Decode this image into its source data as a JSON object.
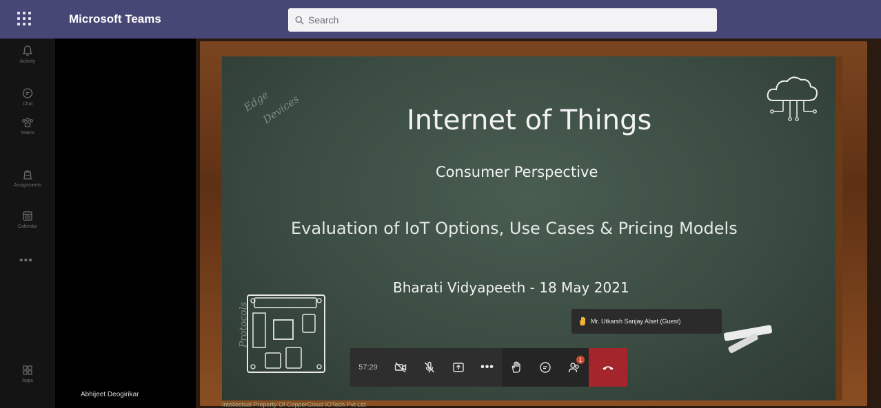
{
  "header": {
    "app_title": "Microsoft Teams",
    "search_placeholder": "Search"
  },
  "rail": {
    "items": [
      {
        "label": "Activity",
        "icon": "bell-icon"
      },
      {
        "label": "Chat",
        "icon": "chat-icon"
      },
      {
        "label": "Teams",
        "icon": "teams-icon"
      },
      {
        "label": "Assignments",
        "icon": "assignments-icon"
      },
      {
        "label": "Calendar",
        "icon": "calendar-icon"
      }
    ],
    "more_label": "•••",
    "apps_label": "Apps"
  },
  "presenter_name": "Abhijeet Deogirikar",
  "slide": {
    "title": "Internet of Things",
    "subtitle": "Consumer Perspective",
    "tagline": "Evaluation of IoT Options, Use Cases & Pricing Models",
    "date_line": "Bharati Vidyapeeth - 18 May 2021",
    "chalk_edge": "Edge",
    "chalk_devices": "Devices",
    "chalk_protocols": "Protocols",
    "footer": "Intellectual Property Of CopperCloud IOTech Pvt Ltd"
  },
  "raised_hand": {
    "name": "Mr. Utkarsh Sanjay Alset (Guest)"
  },
  "call_controls": {
    "timer": "57:29",
    "more_label": "•••",
    "participants_badge": "1",
    "colors": {
      "hangup": "#a4262c",
      "badge": "#cc4a31",
      "hand": "#f2b233"
    }
  },
  "colors": {
    "topbar": "#464775",
    "rail": "#141414",
    "chalkboard": "#3b4c42",
    "frame": "#6b3b18"
  }
}
